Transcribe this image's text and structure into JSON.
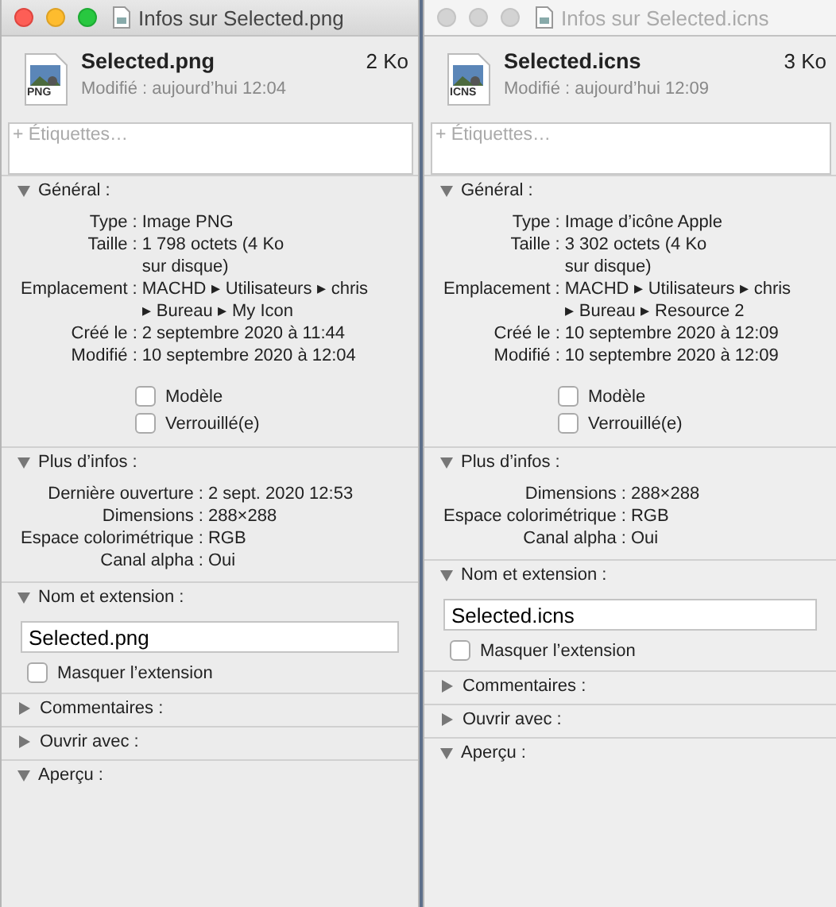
{
  "windows": [
    {
      "active": true,
      "title": "Infos sur Selected.png",
      "file": {
        "icon_label": "PNG",
        "name": "Selected.png",
        "size": "2 Ko",
        "modified": "Modifié : aujourd’hui 12:04"
      },
      "tags": {
        "placeholder": "+ Étiquettes…"
      },
      "sections": [
        {
          "kind": "info",
          "title": "Général :",
          "expanded": true,
          "rows": [
            {
              "label": "Type :",
              "value": [
                "Image PNG"
              ]
            },
            {
              "label": "Taille :",
              "value": [
                "1 798 octets (4 Ko",
                "sur disque)"
              ]
            },
            {
              "label": "Emplacement :",
              "value": [
                "MACHD ▸ Utilisateurs ▸ chris",
                "▸ Bureau ▸ My Icon"
              ]
            },
            {
              "label": "Créé le :",
              "value": [
                "2 septembre 2020 à 11:44"
              ]
            },
            {
              "label": "Modifié :",
              "value": [
                "10 septembre 2020 à 12:04"
              ]
            }
          ],
          "checkboxes": [
            {
              "label": "Modèle",
              "checked": false
            },
            {
              "label": "Verrouillé(e)",
              "checked": false
            }
          ]
        },
        {
          "kind": "info",
          "title": "Plus d’infos :",
          "expanded": true,
          "rows": [
            {
              "label": "Dernière ouverture :",
              "value": [
                "2 sept. 2020 12:53"
              ]
            },
            {
              "label": "Dimensions :",
              "value": [
                "288×288"
              ]
            },
            {
              "label": "Espace colorimétrique :",
              "value": [
                "RGB"
              ]
            },
            {
              "label": "Canal alpha :",
              "value": [
                "Oui"
              ]
            }
          ]
        },
        {
          "kind": "name",
          "title": "Nom et extension :",
          "expanded": true,
          "field": {
            "value": "Selected.png"
          },
          "checkbox": {
            "label": "Masquer l’extension",
            "checked": false
          }
        },
        {
          "kind": "plain",
          "title": "Commentaires :",
          "expanded": false
        },
        {
          "kind": "plain",
          "title": "Ouvrir avec :",
          "expanded": false
        },
        {
          "kind": "plain",
          "title": "Aperçu :",
          "expanded": true
        }
      ]
    },
    {
      "active": false,
      "title": "Infos sur Selected.icns",
      "file": {
        "icon_label": "ICNS",
        "name": "Selected.icns",
        "size": "3 Ko",
        "modified": "Modifié : aujourd’hui 12:09"
      },
      "tags": {
        "placeholder": "+ Étiquettes…"
      },
      "sections": [
        {
          "kind": "info",
          "title": "Général :",
          "expanded": true,
          "rows": [
            {
              "label": "Type :",
              "value": [
                "Image d’icône Apple"
              ]
            },
            {
              "label": "Taille :",
              "value": [
                "3 302 octets (4 Ko",
                "sur disque)"
              ]
            },
            {
              "label": "Emplacement :",
              "value": [
                "MACHD ▸ Utilisateurs ▸ chris",
                "▸ Bureau ▸ Resource 2"
              ]
            },
            {
              "label": "Créé le :",
              "value": [
                "10 septembre 2020 à 12:09"
              ]
            },
            {
              "label": "Modifié :",
              "value": [
                "10 septembre 2020 à 12:09"
              ]
            }
          ],
          "checkboxes": [
            {
              "label": "Modèle",
              "checked": false
            },
            {
              "label": "Verrouillé(e)",
              "checked": false
            }
          ]
        },
        {
          "kind": "info",
          "title": "Plus d’infos :",
          "expanded": true,
          "rows": [
            {
              "label": "Dimensions :",
              "value": [
                "288×288"
              ]
            },
            {
              "label": "Espace colorimétrique :",
              "value": [
                "RGB"
              ]
            },
            {
              "label": "Canal alpha :",
              "value": [
                "Oui"
              ]
            }
          ]
        },
        {
          "kind": "name",
          "title": "Nom et extension :",
          "expanded": true,
          "field": {
            "value": "Selected.icns"
          },
          "checkbox": {
            "label": "Masquer l’extension",
            "checked": false
          }
        },
        {
          "kind": "plain",
          "title": "Commentaires :",
          "expanded": false
        },
        {
          "kind": "plain",
          "title": "Ouvrir avec :",
          "expanded": false
        },
        {
          "kind": "plain",
          "title": "Aperçu :",
          "expanded": true
        }
      ]
    }
  ]
}
